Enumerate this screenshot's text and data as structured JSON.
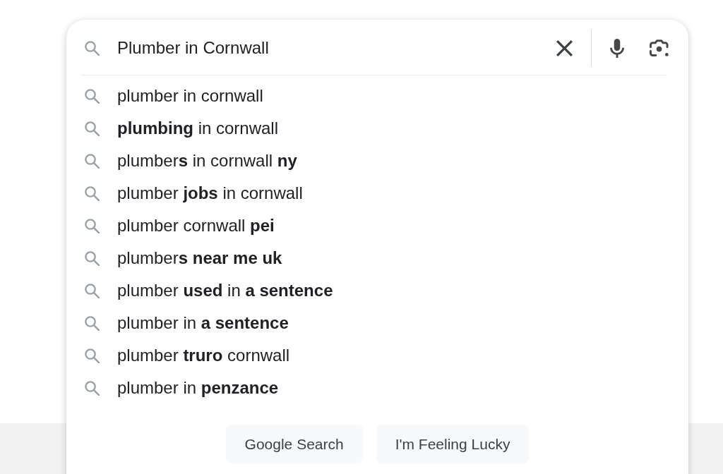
{
  "search": {
    "query": "Plumber in Cornwall"
  },
  "suggestions": [
    "plumber in cornwall",
    "**plumbing** in cornwall",
    "plumber**s** in cornwall **ny**",
    "plumber **jobs** in cornwall",
    "plumber cornwall **pei**",
    "plumber**s near me uk**",
    "plumber **used** in **a sentence**",
    "plumber in **a sentence**",
    "plumber **truro** cornwall",
    "plumber in **penzance**"
  ],
  "buttons": [
    {
      "label": "Google Search"
    },
    {
      "label": "I'm Feeling Lucky"
    }
  ]
}
